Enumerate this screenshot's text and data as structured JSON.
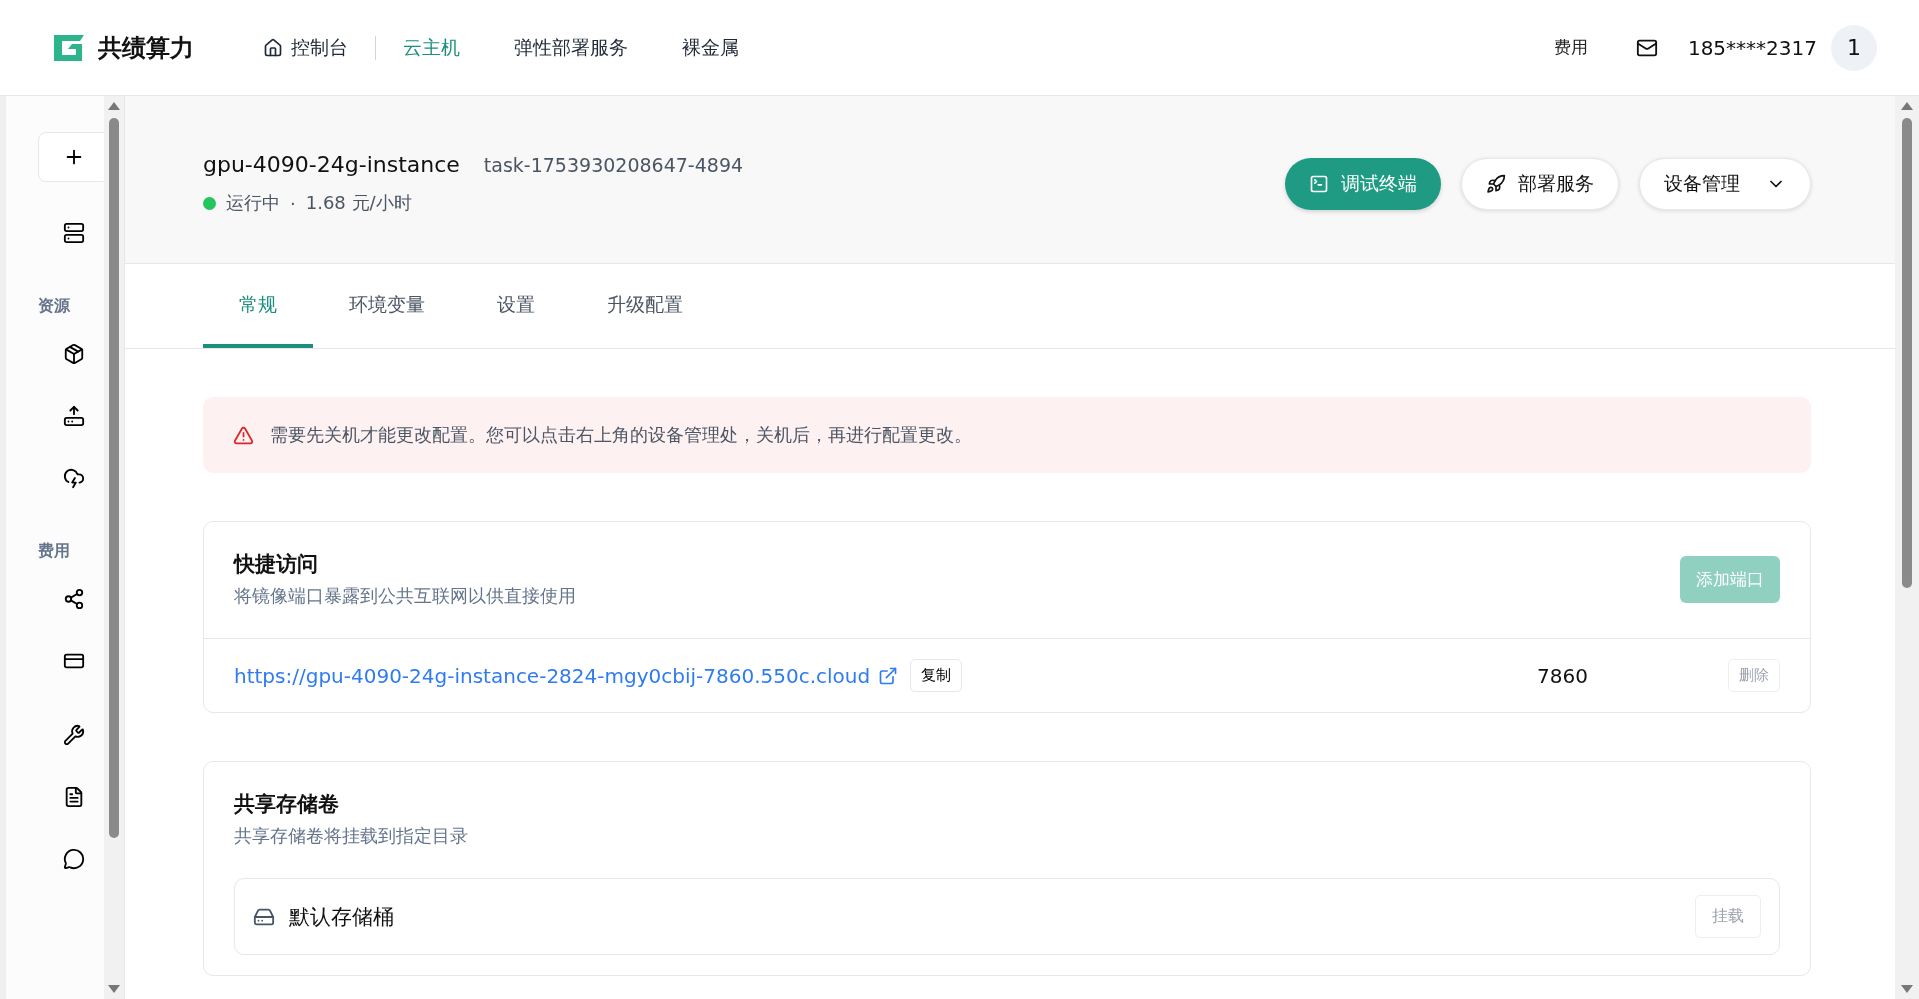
{
  "header": {
    "logo_text": "共绩算力",
    "nav": [
      {
        "label": "控制台",
        "selected": false
      },
      {
        "label": "云主机",
        "selected": true
      },
      {
        "label": "弹性部署服务",
        "selected": false
      },
      {
        "label": "裸金属",
        "selected": false
      }
    ],
    "billing": "费用",
    "user": "185****2317",
    "avatar": "1"
  },
  "sidebar": {
    "sections": [
      {
        "items": [
          {
            "kind": "add"
          },
          {
            "kind": "icon"
          }
        ]
      },
      {
        "title": "资源",
        "items": [
          {
            "kind": "icon"
          },
          {
            "kind": "icon"
          },
          {
            "kind": "icon"
          }
        ]
      },
      {
        "title": "费用",
        "items": [
          {
            "kind": "icon"
          },
          {
            "kind": "icon"
          }
        ]
      },
      {
        "items": [
          {
            "kind": "icon"
          },
          {
            "kind": "icon"
          },
          {
            "kind": "icon"
          }
        ]
      }
    ]
  },
  "instance": {
    "name": "gpu-4090-24g-instance",
    "task": "task-1753930208647-4894",
    "status": "运行中",
    "running": true,
    "separator": "·",
    "price": "1.68 元/小时",
    "actions": [
      {
        "label": "调试终端",
        "kind": "primary"
      },
      {
        "label": "部署服务",
        "kind": "outline"
      },
      {
        "label": "设备管理",
        "kind": "dropdown"
      }
    ]
  },
  "tabs": [
    {
      "label": "常规",
      "selected": true
    },
    {
      "label": "环境变量",
      "selected": false
    },
    {
      "label": "设置",
      "selected": false
    },
    {
      "label": "升级配置",
      "selected": false
    }
  ],
  "alert": "需要先关机才能更改配置。您可以点击右上角的设备管理处，关机后，再进行配置更改。",
  "quick_access": {
    "title": "快捷访问",
    "subtitle": "将镜像端口暴露到公共互联网以供直接使用",
    "add_button": {
      "label": "添加端口",
      "disabled": true
    },
    "rows": [
      {
        "url": "https://gpu-4090-24g-instance-2824-mgy0cbij-7860.550c.cloud",
        "copy": "复制",
        "port": "7860",
        "delete": "删除"
      }
    ]
  },
  "storage": {
    "title": "共享存储卷",
    "subtitle": "共享存储卷将挂载到指定目录",
    "buckets": [
      {
        "name": "默认存储桶",
        "action": "挂载"
      }
    ]
  }
}
